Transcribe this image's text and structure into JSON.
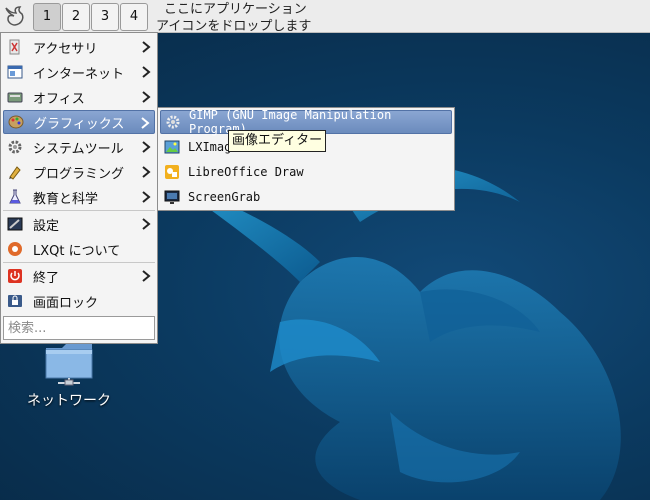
{
  "panel": {
    "desktops": [
      "1",
      "2",
      "3",
      "4"
    ],
    "active_desktop": "1",
    "drop_hint_line1": "ここにアプリケーション",
    "drop_hint_line2": "アイコンをドロップします"
  },
  "menu": {
    "items": [
      {
        "label": "アクセサリ",
        "icon": "accessories-icon",
        "submenu": true
      },
      {
        "label": "インターネット",
        "icon": "internet-icon",
        "submenu": true
      },
      {
        "label": "オフィス",
        "icon": "office-icon",
        "submenu": true
      },
      {
        "label": "グラフィックス",
        "icon": "graphics-icon",
        "submenu": true,
        "highlighted": true
      },
      {
        "label": "システムツール",
        "icon": "system-tools-icon",
        "submenu": true
      },
      {
        "label": "プログラミング",
        "icon": "programming-icon",
        "submenu": true
      },
      {
        "label": "教育と科学",
        "icon": "education-icon",
        "submenu": true
      },
      {
        "label": "設定",
        "icon": "settings-icon",
        "submenu": true
      },
      {
        "label": "LXQt について",
        "icon": "about-lxqt-icon",
        "submenu": false
      },
      {
        "label": "終了",
        "icon": "leave-icon",
        "submenu": true
      },
      {
        "label": "画面ロック",
        "icon": "lock-screen-icon",
        "submenu": false
      }
    ],
    "search_placeholder": "検索..."
  },
  "graphics_submenu": {
    "items": [
      {
        "label": "GIMP (GNU Image Manipulation Program)",
        "icon": "gimp-icon",
        "highlighted": true
      },
      {
        "label": "LXImage",
        "icon": "lximage-icon"
      },
      {
        "label": "LibreOffice Draw",
        "icon": "libreoffice-draw-icon"
      },
      {
        "label": "ScreenGrab",
        "icon": "screengrab-icon"
      }
    ]
  },
  "tooltip": "画像エディター",
  "desktop_icons": [
    {
      "label": "ネットワーク",
      "icon": "network-folder-icon"
    }
  ],
  "colors": {
    "highlight": "#6b8bbd",
    "desktop_bg": "#0b3a60",
    "panel_bg": "#ececec"
  }
}
